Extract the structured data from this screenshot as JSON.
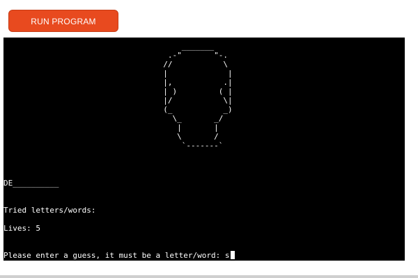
{
  "toolbar": {
    "run_label": "RUN PROGRAM",
    "run_color": "#e84a1f"
  },
  "terminal": {
    "ascii_art": "      _______\n   .-\"       \"-.\n  //           \\\n  |             |\n  |,           .|\n  | )         ( |\n  |/           \\|\n  (_           _)\n    \\_       _/\n     |       |\n     \\       /\n      `-------`",
    "word_progress": "DE__________",
    "tried_label": "Tried letters/words:",
    "lives_label": "Lives: 5",
    "prompt": "Please enter a guess, it must be a letter/word: ",
    "input_value": "s"
  }
}
